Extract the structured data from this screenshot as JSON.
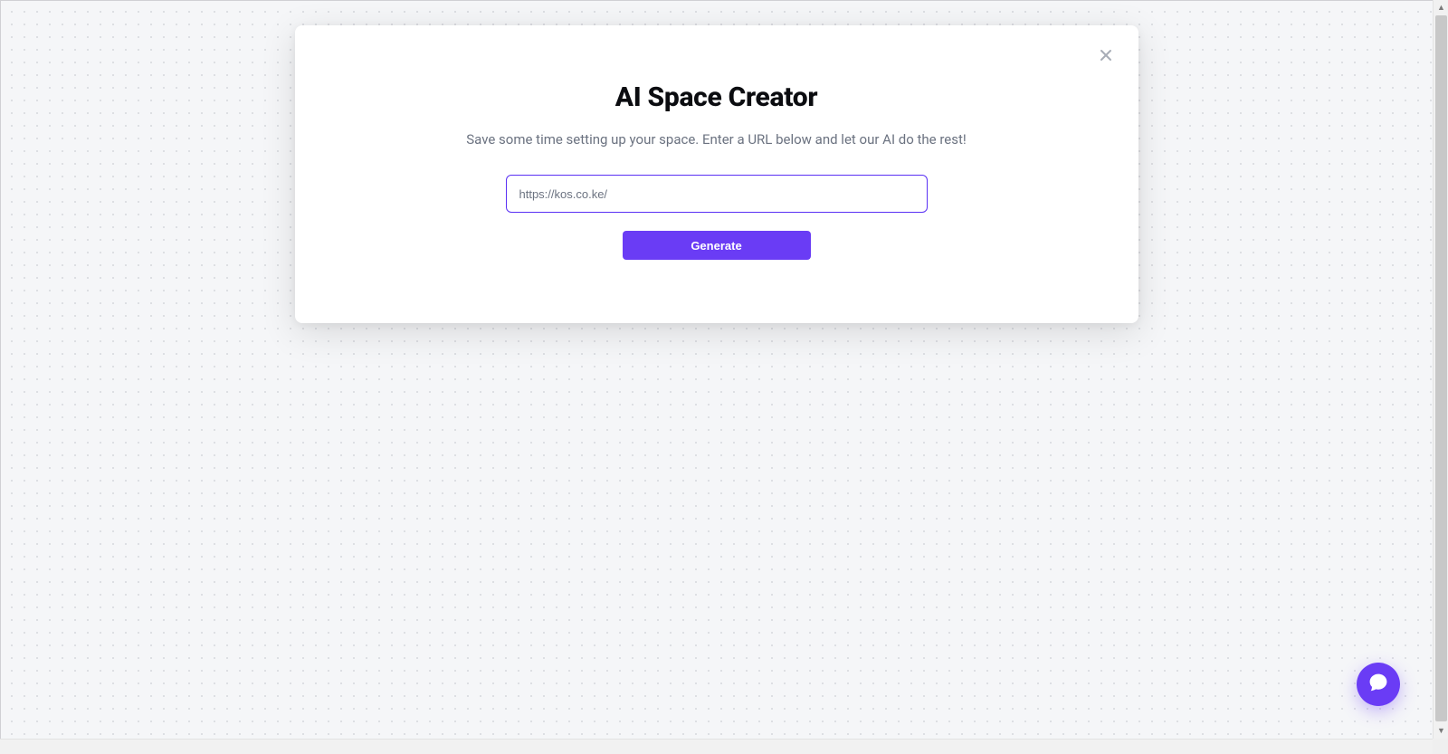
{
  "modal": {
    "title": "AI Space Creator",
    "subtitle": "Save some time setting up your space. Enter a URL below and let our AI do the rest!",
    "url_input": {
      "value": "https://kos.co.ke/",
      "placeholder": ""
    },
    "generate_label": "Generate"
  },
  "colors": {
    "accent": "#6a3cf5",
    "input_border_focus": "#5a31f4",
    "text_muted": "#6b7280"
  }
}
